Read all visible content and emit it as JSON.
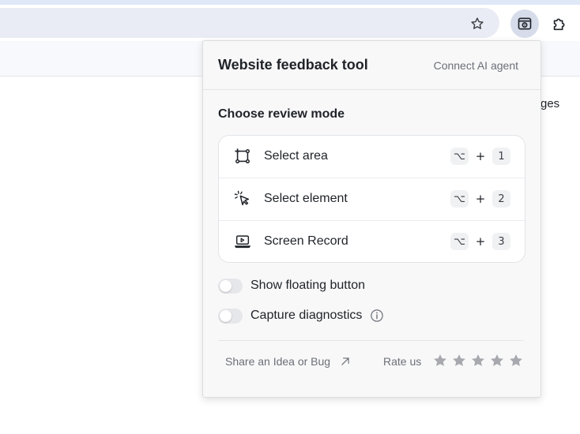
{
  "browser": {
    "icons": {
      "bookmark": "star-outline-icon",
      "extension": "feedback-extension-icon",
      "extensions_menu": "puzzle-icon"
    },
    "page_text_partial": "ges"
  },
  "popup": {
    "title": "Website feedback tool",
    "connect_label": "Connect AI agent",
    "section_title": "Choose review mode",
    "modes": [
      {
        "label": "Select area",
        "icon": "select-area-icon",
        "modifier": "⌥",
        "plus": "+",
        "key": "1"
      },
      {
        "label": "Select element",
        "icon": "cursor-click-icon",
        "modifier": "⌥",
        "plus": "+",
        "key": "2"
      },
      {
        "label": "Screen Record",
        "icon": "laptop-record-icon",
        "modifier": "⌥",
        "plus": "+",
        "key": "3"
      }
    ],
    "toggles": [
      {
        "label": "Show floating button",
        "on": false
      },
      {
        "label": "Capture diagnostics",
        "on": false,
        "has_info": true
      }
    ],
    "footer": {
      "share_label": "Share an Idea or Bug",
      "rate_label": "Rate us",
      "stars": 5
    },
    "colors": {
      "star": "#a7a9ae",
      "muted_text": "#6b6f76"
    }
  }
}
